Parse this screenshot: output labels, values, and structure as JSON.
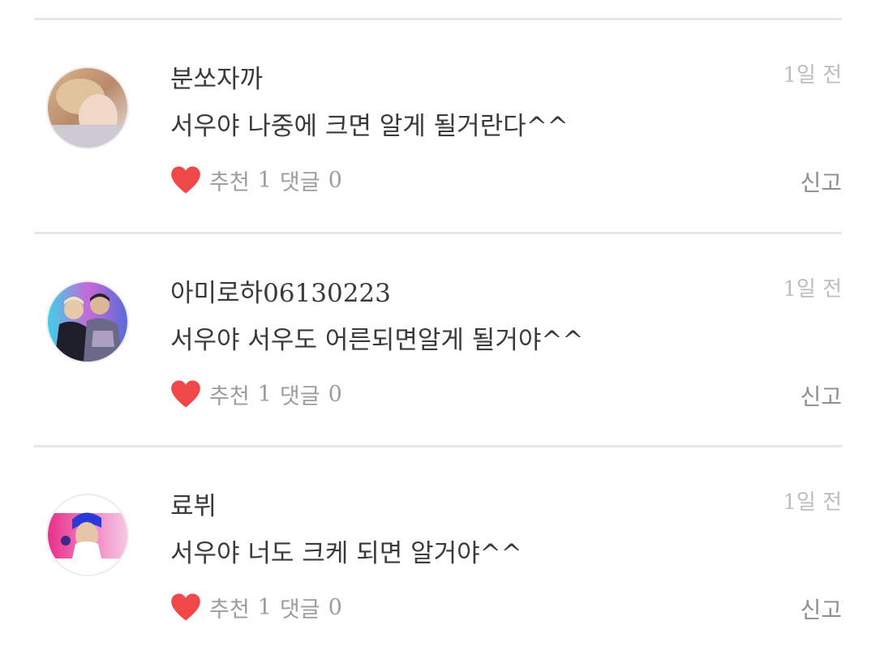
{
  "comments": [
    {
      "username": "분쏘자까",
      "time": "1일 전",
      "text": "서우야 나중에 크면 알게 될거란다^^",
      "recommend_label": "추천",
      "recommend_count": "1",
      "reply_label": "댓글",
      "reply_count": "0",
      "report_label": "신고"
    },
    {
      "username": "아미로하06130223",
      "time": "1일 전",
      "text": "서우야 서우도 어른되면알게 될거야^^",
      "recommend_label": "추천",
      "recommend_count": "1",
      "reply_label": "댓글",
      "reply_count": "0",
      "report_label": "신고"
    },
    {
      "username": "료뷔",
      "time": "1일 전",
      "text": "서우야 너도 크케 되면 알거야^^",
      "recommend_label": "추천",
      "recommend_count": "1",
      "reply_label": "댓글",
      "reply_count": "0",
      "report_label": "신고"
    }
  ],
  "icons": {
    "recommend": "heart-icon"
  },
  "colors": {
    "heart": "#f04848",
    "divider": "#e6e6e6",
    "muted_text": "#bdbdbd"
  }
}
